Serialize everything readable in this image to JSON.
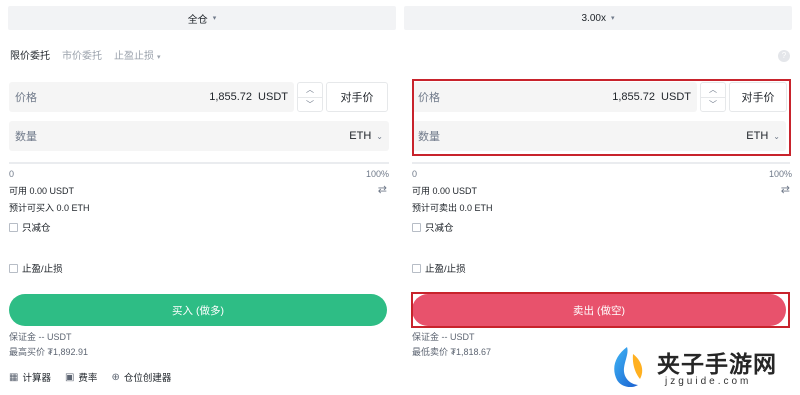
{
  "top": {
    "margin_mode": "全仓",
    "leverage": "3.00x"
  },
  "tabs": {
    "items": [
      "限价委托",
      "市价委托",
      "止盈止损"
    ]
  },
  "buy_panel": {
    "price_label": "价格",
    "price_value": "1,855.72",
    "price_unit": "USDT",
    "bbo_label": "对手价",
    "qty_label": "数量",
    "qty_unit": "ETH",
    "slider_min": "0",
    "slider_max": "100%",
    "available": "可用 0.00 USDT",
    "estimate": "预计可买入 0.0 ETH",
    "reduce_only": "只减仓",
    "tp_sl": "止盈/止损",
    "action_label": "买入 (做多)",
    "margin": "保证金 -- USDT",
    "limit_price": "最高买价 ₮1,892.91"
  },
  "sell_panel": {
    "price_label": "价格",
    "price_value": "1,855.72",
    "price_unit": "USDT",
    "bbo_label": "对手价",
    "qty_label": "数量",
    "qty_unit": "ETH",
    "slider_min": "0",
    "slider_max": "100%",
    "available": "可用 0.00 USDT",
    "estimate": "预计可卖出 0.0 ETH",
    "reduce_only": "只减仓",
    "tp_sl": "止盈/止损",
    "action_label": "卖出 (做空)",
    "margin": "保证金 -- USDT",
    "limit_price": "最低卖价 ₮1,818.67"
  },
  "tools": {
    "calculator": "计算器",
    "funding_rate": "费率",
    "position_builder": "仓位创建器"
  },
  "watermark": {
    "title": "夹子手游网",
    "url": "jzguide.com"
  },
  "colors": {
    "buy": "#2ebd85",
    "sell": "#e8526c",
    "highlight": "#c8232c"
  }
}
